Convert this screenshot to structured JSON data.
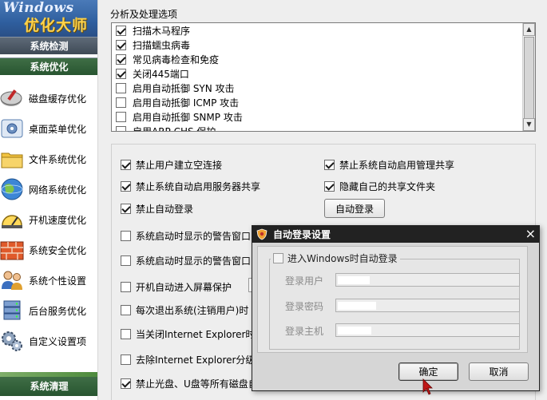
{
  "sidebar": {
    "logo_en": "Windows",
    "logo_cn": "优化大师",
    "section_check": "系统检测",
    "section_optimize": "系统优化",
    "items": [
      {
        "label": "磁盘缓存优化",
        "icon": "disk-cache-icon"
      },
      {
        "label": "桌面菜单优化",
        "icon": "desktop-menu-icon"
      },
      {
        "label": "文件系统优化",
        "icon": "folder-icon"
      },
      {
        "label": "网络系统优化",
        "icon": "globe-icon"
      },
      {
        "label": "开机速度优化",
        "icon": "speed-icon"
      },
      {
        "label": "系统安全优化",
        "icon": "firewall-brick-icon"
      },
      {
        "label": "系统个性设置",
        "icon": "users-icon"
      },
      {
        "label": "后台服务优化",
        "icon": "server-icon"
      },
      {
        "label": "自定义设置项",
        "icon": "gears-icon"
      }
    ],
    "selected_index": 5,
    "section_clean": "系统清理"
  },
  "main": {
    "analysis_title": "分析及处理选项",
    "analysis_items": [
      {
        "label": "扫描木马程序",
        "checked": true
      },
      {
        "label": "扫描蠕虫病毒",
        "checked": true
      },
      {
        "label": "常见病毒检查和免疫",
        "checked": true
      },
      {
        "label": "关闭445端口",
        "checked": true
      },
      {
        "label": "启用自动抵御 SYN 攻击",
        "checked": false
      },
      {
        "label": "启用自动抵御 ICMP 攻击",
        "checked": false
      },
      {
        "label": "启用自动抵御 SNMP 攻击",
        "checked": false
      },
      {
        "label": "启用ARP CHS 保护",
        "checked": false
      }
    ],
    "options": {
      "forbid_empty_connection": "禁止用户建立空连接",
      "forbid_admin_share": "禁止系统自动启用管理共享",
      "forbid_server_share": "禁止系统自动启用服务器共享",
      "hide_shared_folders": "隐藏自己的共享文件夹",
      "forbid_auto_login": "禁止自动登录",
      "auto_login_button": "自动登录",
      "startup_warning_1": "系统启动时显示的警告窗口:",
      "startup_warning_2": "系统启动时显示的警告窗口",
      "auto_screensaver": "开机自动进入屏幕保护",
      "logout_each_time": "每次退出系统(注销用户)时",
      "close_ie": "当关闭Internet Explorer时",
      "remove_ie": "去除Internet Explorer分级",
      "forbid_disc_usb": "禁止光盘、U盘等所有磁盘自"
    }
  },
  "dialog": {
    "title": "自动登录设置",
    "close_glyph": "×",
    "enter_windows_label": "进入Windows时自动登录",
    "login_user_label": "登录用户",
    "login_password_label": "登录密码",
    "login_host_label": "登录主机",
    "ok_label": "确定",
    "cancel_label": "取消"
  }
}
